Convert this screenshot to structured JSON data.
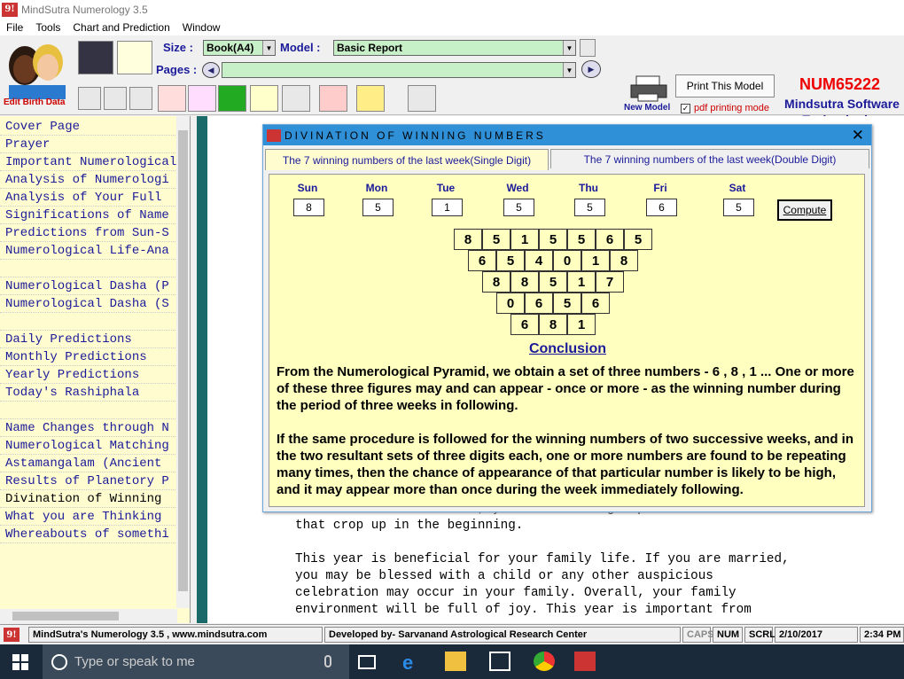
{
  "window": {
    "title": "MindSutra Numerology 3.5",
    "app_logo": "9!"
  },
  "menu": [
    "File",
    "Tools",
    "Chart and Prediction",
    "Window"
  ],
  "toolbar": {
    "edit_birth_data": "Edit Birth Data",
    "size_label": "Size :",
    "size_value": "Book(A4)",
    "model_label": "Model :",
    "model_value": "Basic Report",
    "pages_label": "Pages :",
    "pages_value": "",
    "new_model": "New Model",
    "print_button": "Print This Model",
    "pdf_printing": "pdf printing mode",
    "pdf_checked": true,
    "code": "NUM65222",
    "brand_line1": "Mindsutra Software",
    "brand_line2": "Technologies"
  },
  "sidebar": {
    "items": [
      "Cover Page",
      "Prayer",
      "Important Numerological",
      "Analysis of Numerologi",
      "Analysis of Your Full",
      "Significations of Name",
      "Predictions from Sun-S",
      "Numerological Life-Ana",
      "",
      "Numerological Dasha (P",
      "Numerological Dasha (S",
      "",
      "Daily Predictions",
      "Monthly Predictions",
      "Yearly Predictions",
      "Today's Rashiphala",
      "",
      "Name Changes through N",
      "Numerological Matching",
      "Astamangalam (Ancient",
      "Results of Planetory P",
      "Divination of Winning",
      "What you are Thinking",
      "Whereabouts of somethi"
    ],
    "selected_index": 21
  },
  "content": {
    "text": "will increase. Therefore, you should not get panic from troubles\nthat crop up in the beginning.\n\nThis year is beneficial for your family life. If you are married,\nyou may be blessed with a child or any other auspicious\ncelebration may occur in your family. Overall, your family\nenvironment will be full of joy. This year is important from"
  },
  "dialog": {
    "title": "DIVINATION OF WINNING NUMBERS",
    "tabs": [
      "The 7 winning numbers of the last week(Single Digit)",
      "The 7 winning numbers of the last week(Double Digit)"
    ],
    "active_tab": 0,
    "days": [
      {
        "name": "Sun",
        "value": "8"
      },
      {
        "name": "Mon",
        "value": "5"
      },
      {
        "name": "Tue",
        "value": "1"
      },
      {
        "name": "Wed",
        "value": "5"
      },
      {
        "name": "Thu",
        "value": "5"
      },
      {
        "name": "Fri",
        "value": "6"
      },
      {
        "name": "Sat",
        "value": "5"
      }
    ],
    "compute_label": "Compute",
    "pyramid": [
      [
        "8",
        "5",
        "1",
        "5",
        "5",
        "6",
        "5"
      ],
      [
        "6",
        "5",
        "4",
        "0",
        "1",
        "8"
      ],
      [
        "8",
        "8",
        "5",
        "1",
        "7"
      ],
      [
        "0",
        "6",
        "5",
        "6"
      ],
      [
        "6",
        "8",
        "1"
      ]
    ],
    "conclusion_title": "Conclusion",
    "paragraph1": "From the Numerological Pyramid, we obtain a set of three numbers - 6 , 8 , 1 ... One or more of these three figures may and can appear - once or more - as the winning number during the period of three weeks in following.",
    "paragraph2": "If the same procedure is followed for the winning numbers of two successive weeks, and in the two resultant sets of three digits each, one or more numbers are found to be repeating many times, then the chance of appearance of that particular number is likely to be high, and it may appear more than once during the week immediately following."
  },
  "status": {
    "website": "MindSutra's Numerology 3.5 , www.mindsutra.com",
    "developer": "Developed by- Sarvanand Astrological Research Center",
    "caps": "CAPS",
    "num": "NUM",
    "scrl": "SCRL",
    "date": "2/10/2017",
    "time": "2:34 PM"
  },
  "taskbar": {
    "search_placeholder": "Type or speak to me"
  }
}
